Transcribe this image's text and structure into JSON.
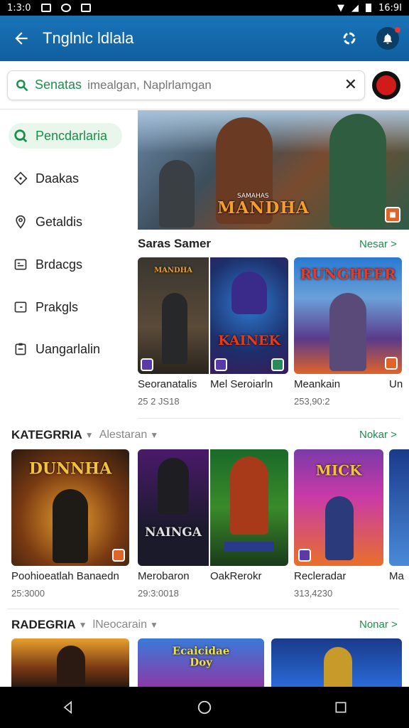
{
  "status": {
    "time": "1:3:0",
    "battery_time": "16:9I"
  },
  "appbar": {
    "title": "Tnglnlc ldlala"
  },
  "search": {
    "label": "Senatas",
    "placeholder": "imealgan, Naplrlamgan"
  },
  "sidebar": {
    "items": [
      {
        "label": "Pencdarlaria",
        "icon": "search-icon",
        "active": true
      },
      {
        "label": "Daakas",
        "icon": "diamond-icon",
        "active": false
      },
      {
        "label": "Getaldis",
        "icon": "location-icon",
        "active": false
      },
      {
        "label": "Brdacgs",
        "icon": "card-icon",
        "active": false
      },
      {
        "label": "Prakgls",
        "icon": "door-icon",
        "active": false
      },
      {
        "label": "Uangarlalin",
        "icon": "clipboard-icon",
        "active": false
      }
    ]
  },
  "hero": {
    "logo_top": "SAMAHAS",
    "logo": "MANDHA"
  },
  "section1": {
    "title": "Saras Samer",
    "more": "Nesar >",
    "cards": [
      {
        "name": "Seoranatalis",
        "count": "25 2 JS18",
        "art": "MANDHA"
      },
      {
        "name": "Mel Seroiarln",
        "count": "",
        "art": "KAINEK"
      },
      {
        "name": "Meankain",
        "count": "253,90:2",
        "art": "RUNGHEER"
      },
      {
        "name": "Un",
        "count": "",
        "art": ""
      }
    ]
  },
  "section2": {
    "title": "KATEGRRIA",
    "sub": "Alestaran",
    "more": "Nokar >",
    "cards": [
      {
        "name": "Poohioeatlah Banaedn",
        "count": "25:3000",
        "art": "DUNNHA"
      },
      {
        "name": "Merobaron",
        "count": "29:3:0018",
        "art": "NAINGA"
      },
      {
        "name": "OakRerokr",
        "count": "",
        "art": ""
      },
      {
        "name": "Recleradar",
        "count": "313,4230",
        "art": "MICK"
      },
      {
        "name": "Ma",
        "count": "",
        "art": ""
      }
    ]
  },
  "section3": {
    "title": "RADEGRIA",
    "sub": "lNeocarain",
    "more": "Nonar >",
    "cards": [
      {
        "art": ""
      },
      {
        "art": "Ecaicidae Doy"
      },
      {
        "art": ""
      }
    ]
  }
}
